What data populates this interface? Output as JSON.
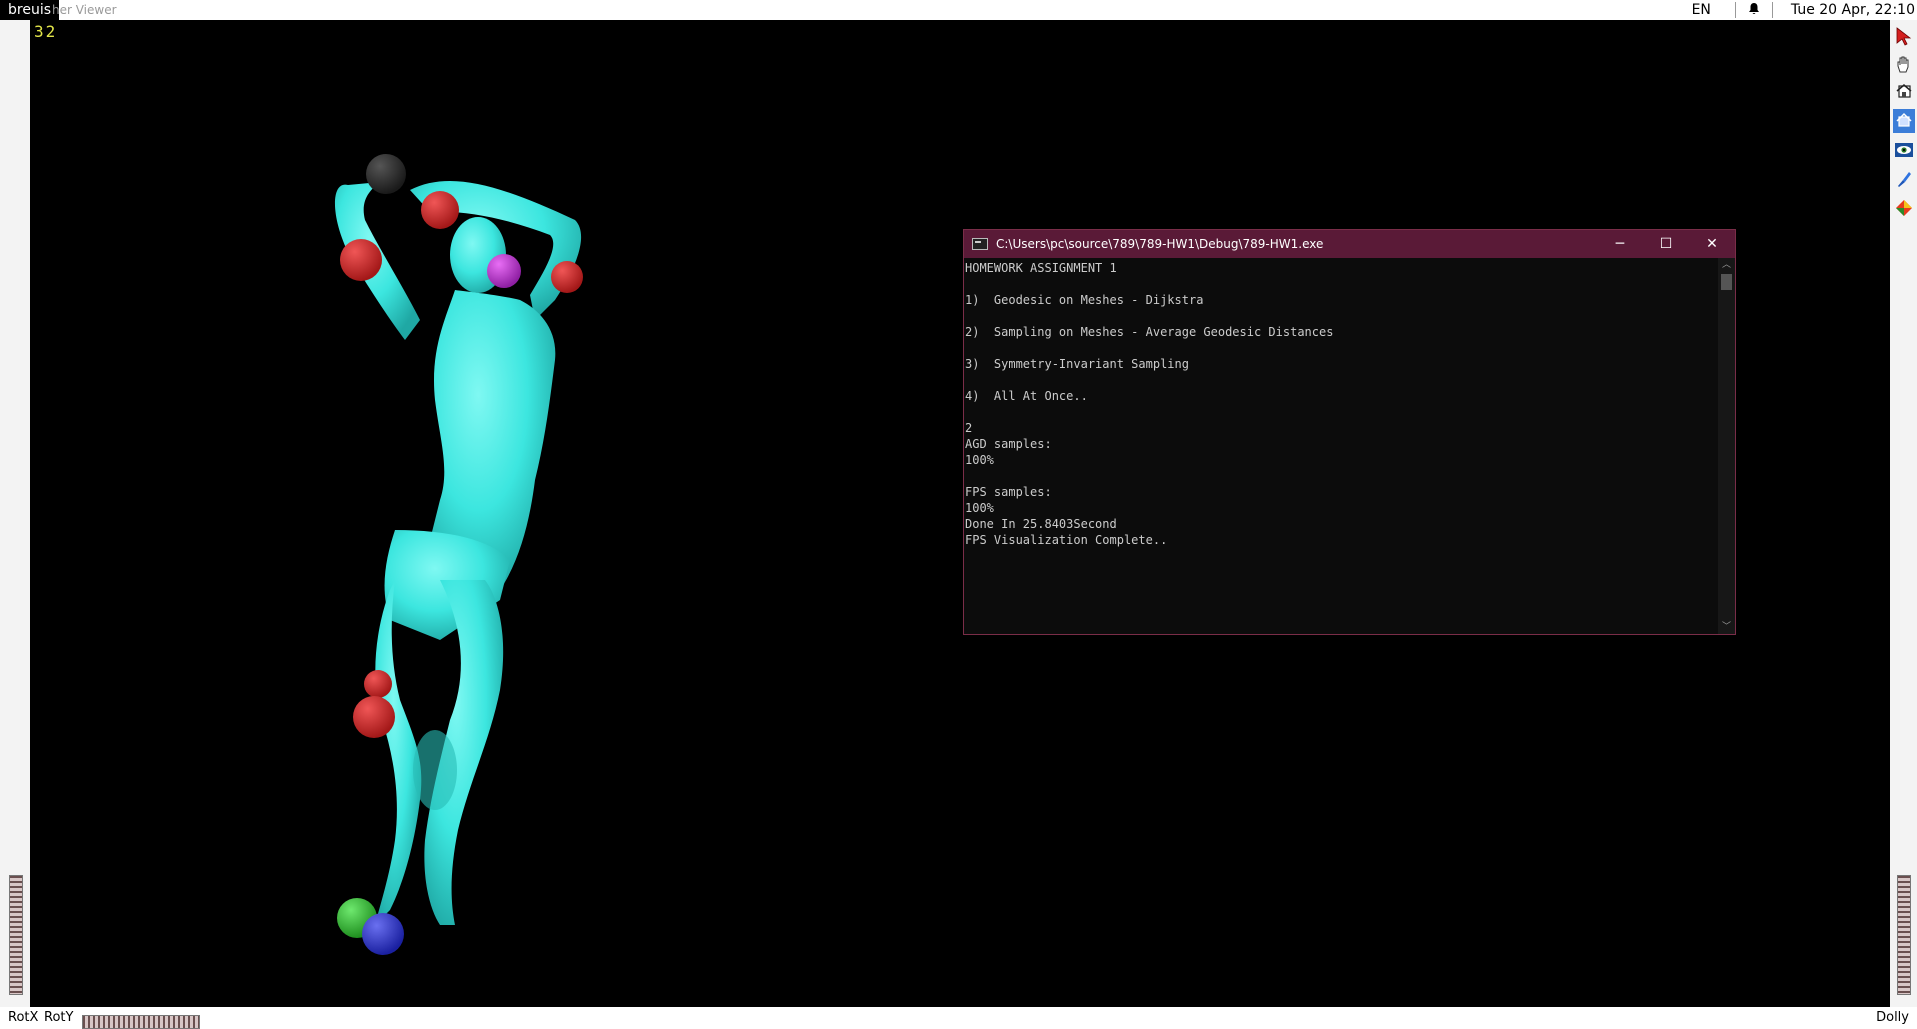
{
  "topbar": {
    "app_tag": "breuis",
    "window_title": "her Viewer",
    "lang": "EN",
    "bell_icon": "bell-icon",
    "clock": "Tue 20 Apr, 22:10"
  },
  "viewer": {
    "fps": "32",
    "mesh_color": "#39e8e0",
    "sample_colors": [
      "#cc2a2a",
      "#b030c8",
      "#2fbf2f",
      "#2d33c7",
      "#333333"
    ]
  },
  "tools": [
    {
      "icon": "pointer-arrow-icon",
      "selected": false
    },
    {
      "icon": "hand-pan-icon",
      "selected": false
    },
    {
      "icon": "home-view-icon",
      "selected": false
    },
    {
      "icon": "set-home-icon",
      "selected": true
    },
    {
      "icon": "eye-view-icon",
      "selected": false
    },
    {
      "icon": "seek-icon",
      "selected": false
    },
    {
      "icon": "perspective-toggle-icon",
      "selected": false
    }
  ],
  "bottombar": {
    "rotx": "RotX",
    "roty": "RotY",
    "dolly": "Dolly"
  },
  "console": {
    "title": "C:\\Users\\pc\\source\\789\\789-HW1\\Debug\\789-HW1.exe",
    "minimize": "─",
    "maximize": "☐",
    "close": "✕",
    "lines": [
      "HOMEWORK ASSIGNMENT 1",
      "",
      "1)  Geodesic on Meshes - Dijkstra",
      "",
      "2)  Sampling on Meshes - Average Geodesic Distances",
      "",
      "3)  Symmetry-Invariant Sampling",
      "",
      "4)  All At Once..",
      "",
      "2",
      "AGD samples:",
      "100%",
      "",
      "FPS samples:",
      "100%",
      "Done In 25.8403Second",
      "FPS Visualization Complete.."
    ]
  }
}
